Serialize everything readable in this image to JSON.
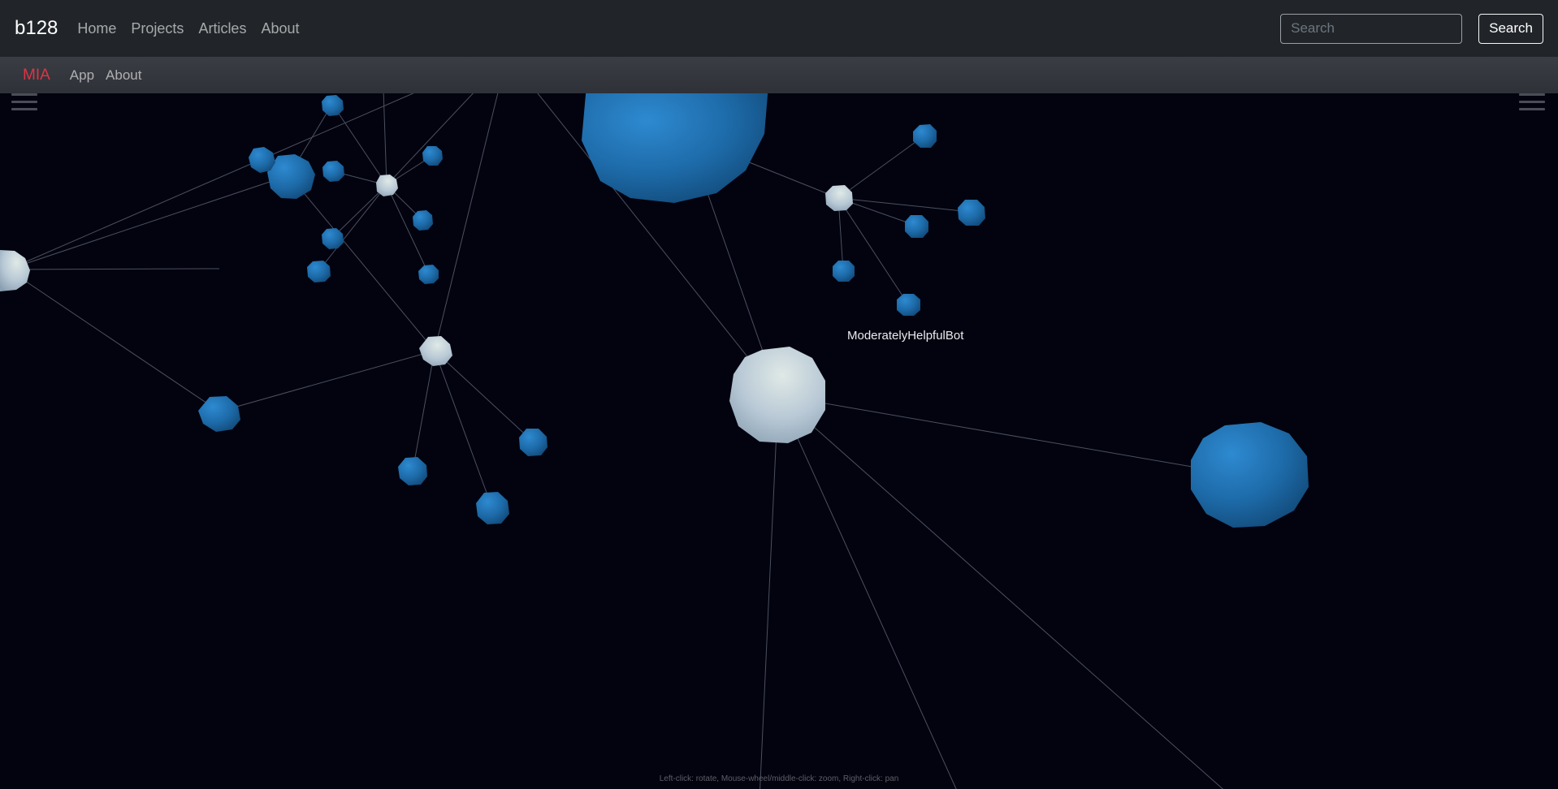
{
  "topnav": {
    "brand": "b128",
    "links": [
      "Home",
      "Projects",
      "Articles",
      "About"
    ],
    "search_placeholder": "Search",
    "search_button": "Search"
  },
  "subnav": {
    "brand": "MIA",
    "links": [
      "App",
      "About"
    ]
  },
  "graph": {
    "hovered_label": "ModeratelyHelpfulBot",
    "help_text": "Left-click: rotate, Mouse-wheel/middle-click: zoom, Right-click: pan",
    "colors": {
      "background": "#03030f",
      "node_blue": "#1f6fad",
      "node_white": "#c9d6de",
      "link": "#4b5060"
    },
    "icons": [
      "menu-icon",
      "menu-icon"
    ]
  }
}
